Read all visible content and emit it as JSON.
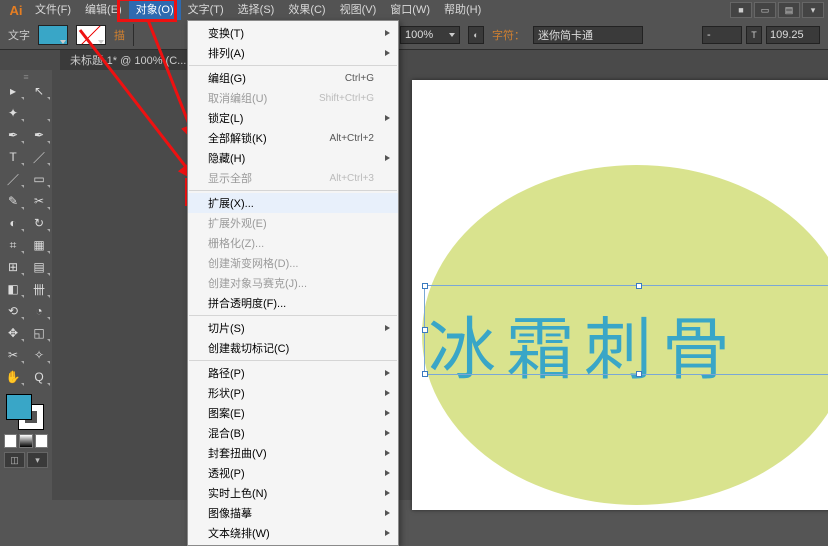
{
  "menubar": {
    "logo": "Ai",
    "items": [
      "文件(F)",
      "编辑(E)",
      "对象(O)",
      "文字(T)",
      "选择(S)",
      "效果(C)",
      "视图(V)",
      "窗口(W)",
      "帮助(H)"
    ],
    "open_index": 2
  },
  "control": {
    "tool_label": "文字",
    "zoom": "100%",
    "font_lbl": "字符：",
    "font_name": "迷你简卡通",
    "hyphen": "-",
    "size": "109.25"
  },
  "tabbar": {
    "tab": "未标题-1* @ 100% (C..."
  },
  "toolbox": {
    "rows": [
      [
        "▸",
        "↖"
      ],
      [
        "✦",
        ""
      ],
      [
        "✒",
        "✒"
      ],
      [
        "T",
        "／"
      ],
      [
        "／",
        "▭"
      ],
      [
        "✎",
        "✂"
      ],
      [
        "◐",
        "↻"
      ],
      [
        "⌗",
        "▦"
      ],
      [
        "⊞",
        "▤"
      ],
      [
        "◧",
        "卌"
      ],
      [
        "⟲",
        "◔"
      ],
      [
        "✥",
        "◱"
      ],
      [
        "✂",
        "✧"
      ],
      [
        "✋",
        "Q"
      ]
    ]
  },
  "canvas": {
    "text": "冰霜刺骨"
  },
  "dropdown": {
    "groups": [
      [
        {
          "l": "变换(T)",
          "sub": true
        },
        {
          "l": "排列(A)",
          "sub": true
        }
      ],
      [
        {
          "l": "编组(G)",
          "sc": "Ctrl+G"
        },
        {
          "l": "取消编组(U)",
          "sc": "Shift+Ctrl+G",
          "dis": true
        },
        {
          "l": "锁定(L)",
          "sub": true
        },
        {
          "l": "全部解锁(K)",
          "sc": "Alt+Ctrl+2"
        },
        {
          "l": "隐藏(H)",
          "sub": true
        },
        {
          "l": "显示全部",
          "sc": "Alt+Ctrl+3",
          "dis": true
        }
      ],
      [
        {
          "l": "扩展(X)...",
          "hover": true
        },
        {
          "l": "扩展外观(E)",
          "dis": true
        },
        {
          "l": "栅格化(Z)...",
          "dis": true
        },
        {
          "l": "创建渐变网格(D)...",
          "dis": true
        },
        {
          "l": "创建对象马赛克(J)...",
          "dis": true
        },
        {
          "l": "拼合透明度(F)..."
        }
      ],
      [
        {
          "l": "切片(S)",
          "sub": true
        },
        {
          "l": "创建裁切标记(C)"
        }
      ],
      [
        {
          "l": "路径(P)",
          "sub": true
        },
        {
          "l": "形状(P)",
          "sub": true
        },
        {
          "l": "图案(E)",
          "sub": true
        },
        {
          "l": "混合(B)",
          "sub": true
        },
        {
          "l": "封套扭曲(V)",
          "sub": true
        },
        {
          "l": "透视(P)",
          "sub": true
        },
        {
          "l": "实时上色(N)",
          "sub": true
        },
        {
          "l": "图像描摹",
          "sub": true
        },
        {
          "l": "文本绕排(W)",
          "sub": true
        }
      ]
    ]
  }
}
